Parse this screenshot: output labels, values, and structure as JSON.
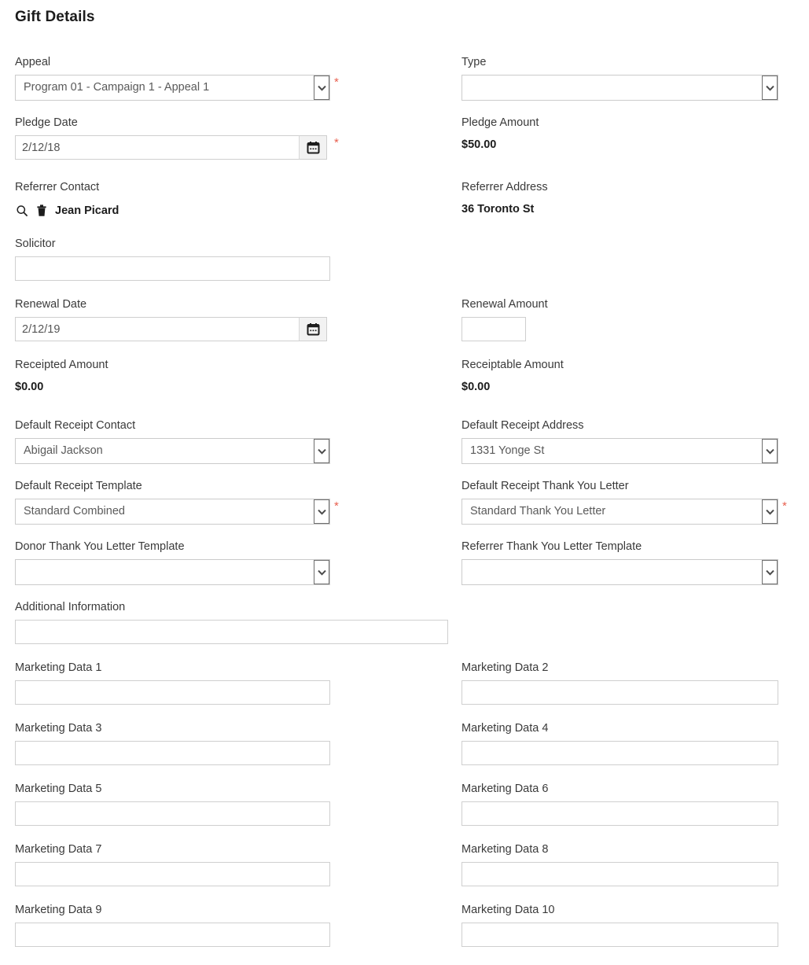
{
  "page": {
    "title": "Gift Details"
  },
  "fields": {
    "appeal": {
      "label": "Appeal",
      "value": "Program 01 - Campaign 1 - Appeal 1",
      "required": "*"
    },
    "type": {
      "label": "Type",
      "value": "",
      "required": ""
    },
    "pledge_date": {
      "label": "Pledge Date",
      "value": "2/12/18",
      "required": "*",
      "icon": "calendar-icon"
    },
    "pledge_amount": {
      "label": "Pledge Amount",
      "value": "$50.00"
    },
    "referrer_contact": {
      "label": "Referrer Contact",
      "value": "Jean Picard",
      "search_icon": "search-icon",
      "delete_icon": "trash-icon"
    },
    "referrer_address": {
      "label": "Referrer Address",
      "value": "36 Toronto St"
    },
    "solicitor": {
      "label": "Solicitor",
      "value": ""
    },
    "renewal_date": {
      "label": "Renewal Date",
      "value": "2/12/19",
      "icon": "calendar-icon"
    },
    "renewal_amount": {
      "label": "Renewal Amount",
      "value": ""
    },
    "receipted_amount": {
      "label": "Receipted Amount",
      "value": "$0.00"
    },
    "receiptable_amount": {
      "label": "Receiptable Amount",
      "value": "$0.00"
    },
    "default_receipt_contact": {
      "label": "Default Receipt Contact",
      "value": "Abigail Jackson"
    },
    "default_receipt_address": {
      "label": "Default Receipt Address",
      "value": "1331 Yonge St"
    },
    "default_receipt_template": {
      "label": "Default Receipt Template",
      "value": "Standard Combined",
      "required": "*"
    },
    "default_receipt_thank_you_letter": {
      "label": "Default Receipt Thank You Letter",
      "value": "Standard Thank You Letter",
      "required": "*"
    },
    "donor_thank_you_letter_template": {
      "label": "Donor Thank You Letter Template",
      "value": ""
    },
    "referrer_thank_you_letter_template": {
      "label": "Referrer Thank You Letter Template",
      "value": ""
    },
    "additional_information": {
      "label": "Additional Information",
      "value": ""
    },
    "marketing_data_1": {
      "label": "Marketing Data 1",
      "value": ""
    },
    "marketing_data_2": {
      "label": "Marketing Data 2",
      "value": ""
    },
    "marketing_data_3": {
      "label": "Marketing Data 3",
      "value": ""
    },
    "marketing_data_4": {
      "label": "Marketing Data 4",
      "value": ""
    },
    "marketing_data_5": {
      "label": "Marketing Data 5",
      "value": ""
    },
    "marketing_data_6": {
      "label": "Marketing Data 6",
      "value": ""
    },
    "marketing_data_7": {
      "label": "Marketing Data 7",
      "value": ""
    },
    "marketing_data_8": {
      "label": "Marketing Data 8",
      "value": ""
    },
    "marketing_data_9": {
      "label": "Marketing Data 9",
      "value": ""
    },
    "marketing_data_10": {
      "label": "Marketing Data 10",
      "value": ""
    }
  },
  "colors": {
    "required_asterisk": "#e8604f",
    "label_text": "#3a3a3a",
    "value_text": "#1c1c1c",
    "input_border": "#cfcfcf",
    "page_background": "#ffffff"
  }
}
